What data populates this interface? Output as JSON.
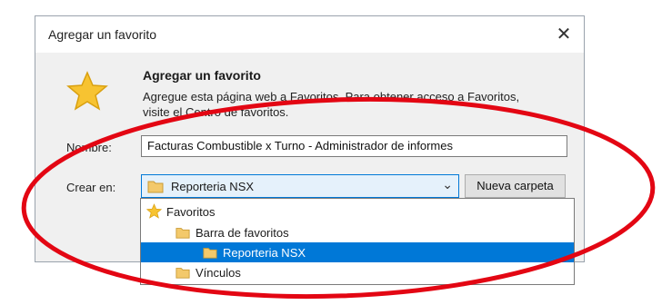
{
  "dialog": {
    "title": "Agregar un favorito",
    "heading": "Agregar un favorito",
    "description": "Agregue esta página web a Favoritos. Para obtener acceso a Favoritos, visite el Centro de favoritos.",
    "name_label": "Nombre:",
    "name_value": "Facturas Combustible x Turno - Administrador de informes",
    "folder_label": "Crear en:",
    "folder_value": "Reporteria NSX",
    "new_folder_button": "Nueva carpeta"
  },
  "folder_tree": [
    {
      "label": "Favoritos",
      "icon": "star-icon",
      "selected": false
    },
    {
      "label": "Barra de favoritos",
      "icon": "folder-icon",
      "selected": false
    },
    {
      "label": "Reporteria NSX",
      "icon": "folder-icon",
      "selected": true
    },
    {
      "label": "Vínculos",
      "icon": "folder-icon",
      "selected": false
    }
  ],
  "colors": {
    "selection": "#0078d7",
    "annotation": "#e30613",
    "star": "#f7c331"
  }
}
